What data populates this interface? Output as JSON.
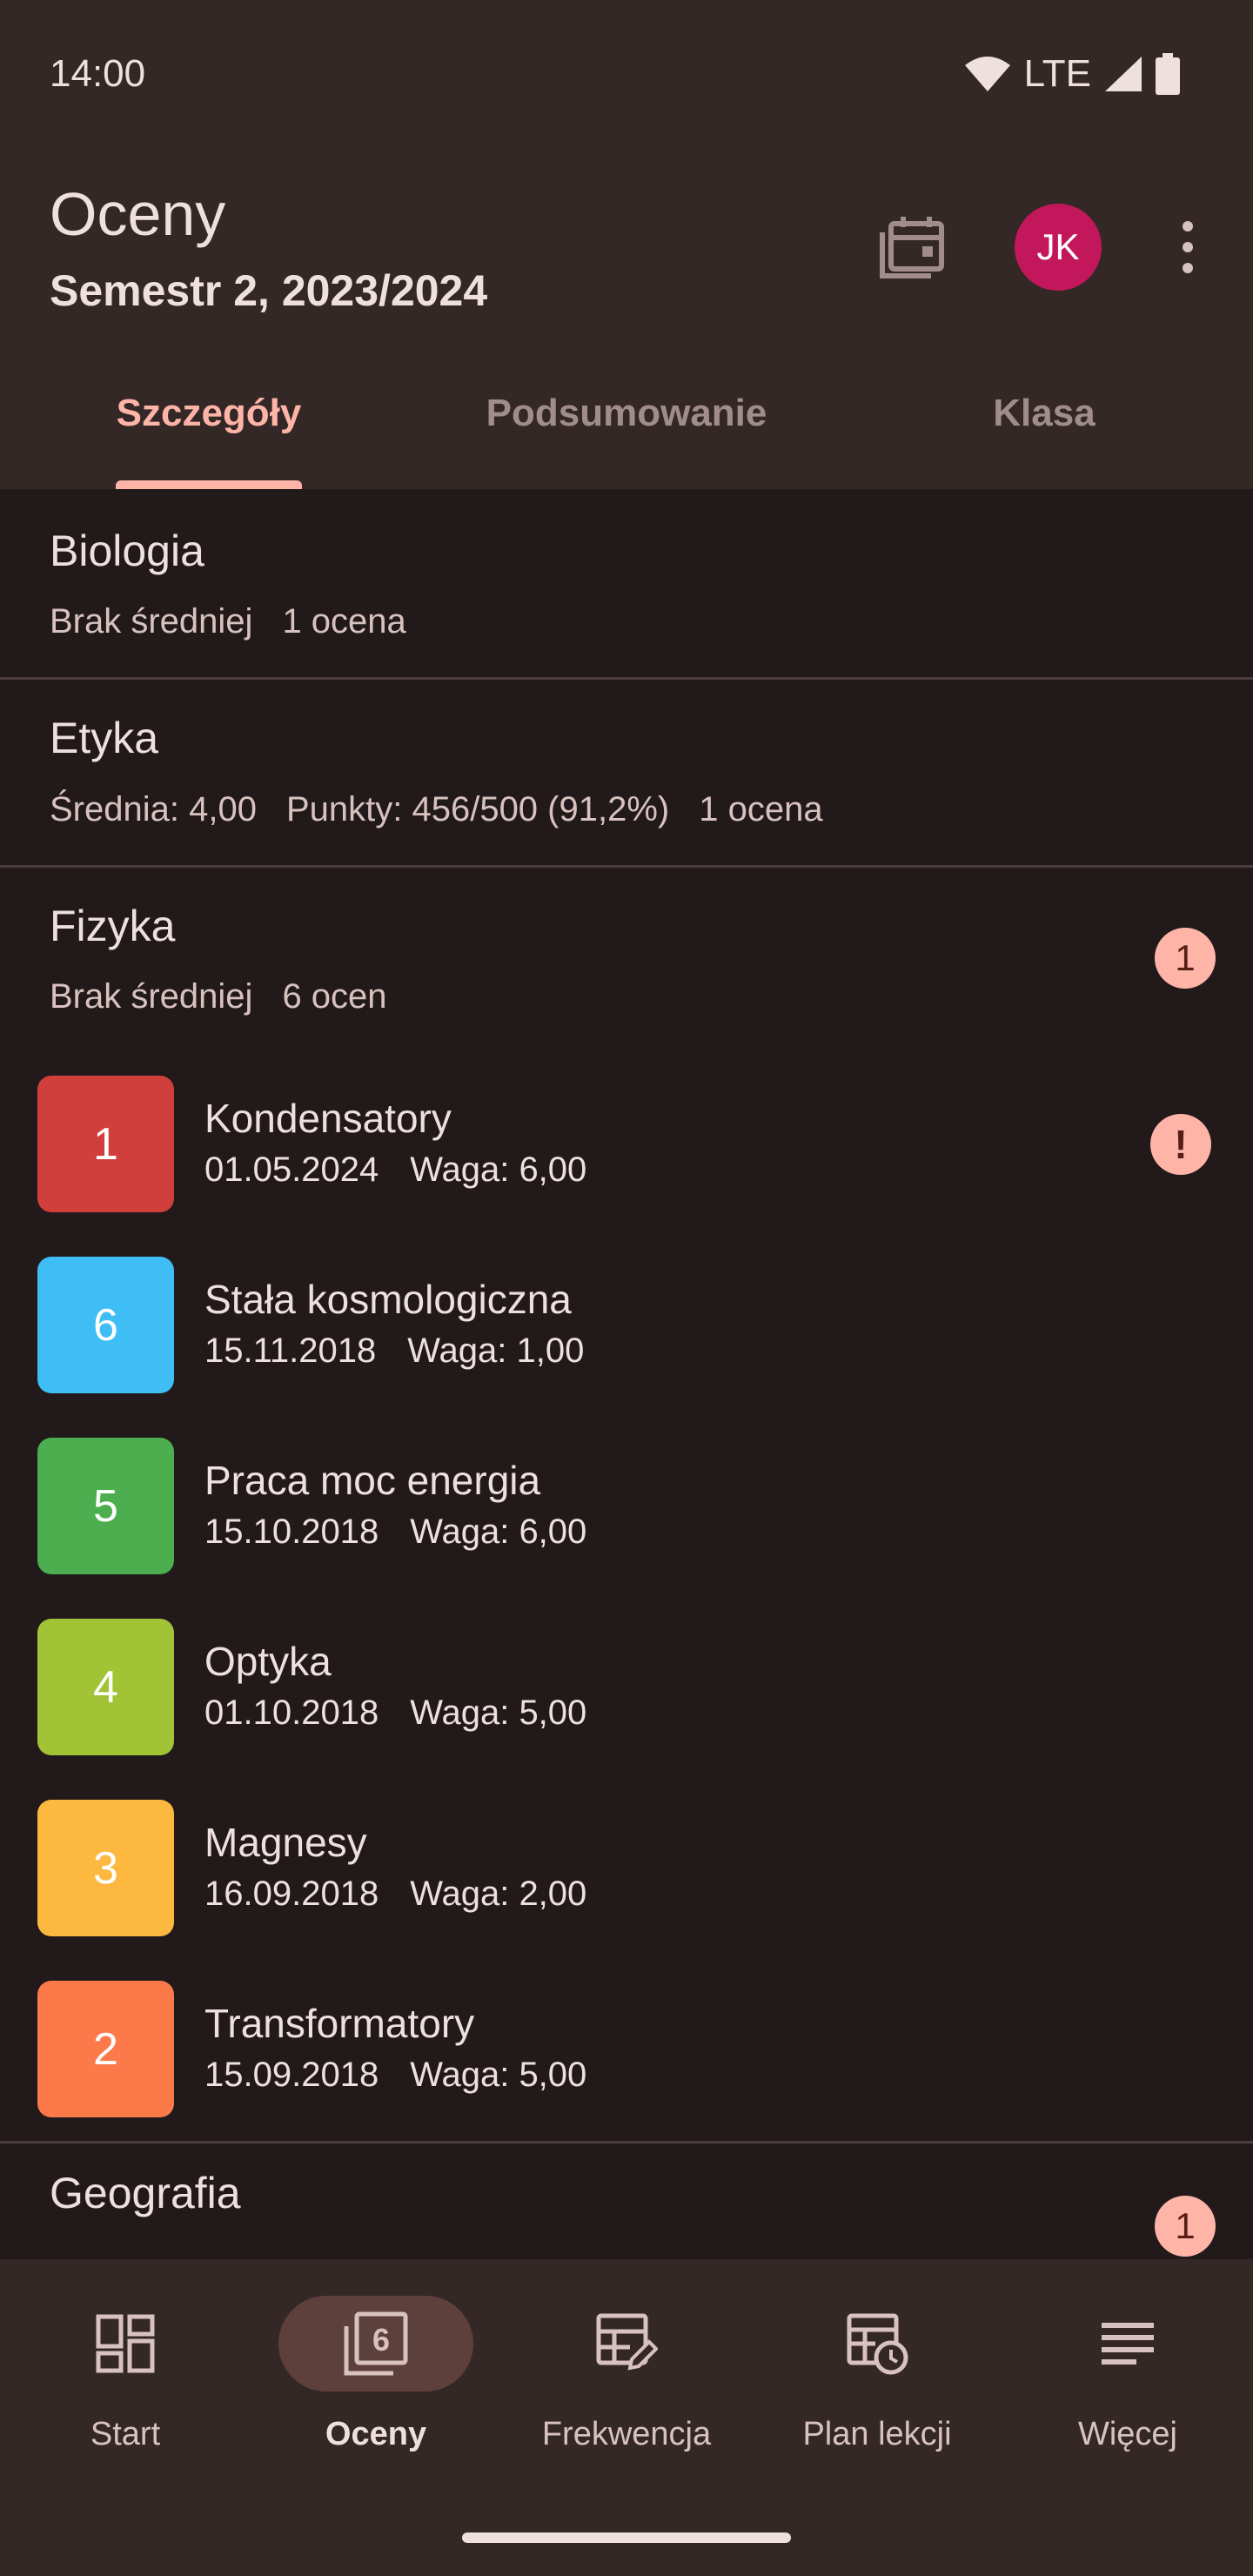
{
  "status": {
    "time": "14:00",
    "network": "LTE",
    "icons": [
      "wifi-icon",
      "cell-signal-icon",
      "battery-icon"
    ]
  },
  "header": {
    "title": "Oceny",
    "subtitle": "Semestr 2, 2023/2024",
    "avatar": "JK",
    "icons": [
      "calendar-icon",
      "more-vert-icon"
    ]
  },
  "tabs": [
    {
      "label": "Szczegóły",
      "active": true
    },
    {
      "label": "Podsumowanie",
      "active": false
    },
    {
      "label": "Klasa",
      "active": false
    }
  ],
  "subjects": [
    {
      "name": "Biologia",
      "average": "Brak średniej",
      "points": "",
      "count": "1 ocena"
    },
    {
      "name": "Etyka",
      "average": "Średnia: 4,00",
      "points": "Punkty: 456/500 (91,2%)",
      "count": "1 ocena"
    },
    {
      "name": "Fizyka",
      "average": "Brak średniej",
      "points": "",
      "count": "6 ocen",
      "badge": "1"
    },
    {
      "name": "Geografia",
      "badge": "1"
    }
  ],
  "grades": [
    {
      "value": "1",
      "title": "Kondensatory",
      "date": "01.05.2024",
      "weight": "Waga: 6,00",
      "color": "#d13f3d",
      "alert": "!"
    },
    {
      "value": "6",
      "title": "Stała kosmologiczna",
      "date": "15.11.2018",
      "weight": "Waga: 1,00",
      "color": "#3fbdf5"
    },
    {
      "value": "5",
      "title": "Praca moc energia",
      "date": "15.10.2018",
      "weight": "Waga: 6,00",
      "color": "#4cae4f"
    },
    {
      "value": "4",
      "title": "Optyka",
      "date": "01.10.2018",
      "weight": "Waga: 5,00",
      "color": "#a1c335"
    },
    {
      "value": "3",
      "title": "Magnesy",
      "date": "16.09.2018",
      "weight": "Waga: 2,00",
      "color": "#fdb840"
    },
    {
      "value": "2",
      "title": "Transformatory",
      "date": "15.09.2018",
      "weight": "Waga: 5,00",
      "color": "#fc794a"
    }
  ],
  "bottom_nav": [
    {
      "label": "Start",
      "icon": "dashboard-icon",
      "active": false
    },
    {
      "label": "Oceny",
      "icon": "grades-icon",
      "active": true,
      "icon_text": "6"
    },
    {
      "label": "Frekwencja",
      "icon": "attendance-icon",
      "active": false
    },
    {
      "label": "Plan lekcji",
      "icon": "timetable-icon",
      "active": false
    },
    {
      "label": "Więcej",
      "icon": "more-menu-icon",
      "active": false
    }
  ]
}
